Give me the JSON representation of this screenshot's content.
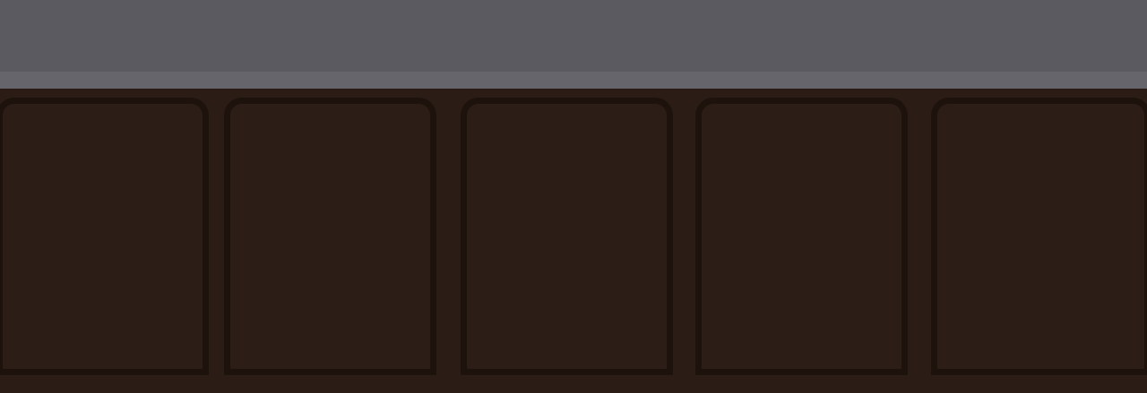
{
  "colors": {
    "top_bar": "#5b5a60",
    "top_strip": "#66656b",
    "panel_area": "#2b1c16",
    "panel_fill": "#2c1d17",
    "panel_border": "#1e120d"
  },
  "panels": [
    {
      "name": "panel-1"
    },
    {
      "name": "panel-2"
    },
    {
      "name": "panel-3"
    },
    {
      "name": "panel-4"
    },
    {
      "name": "panel-5"
    }
  ]
}
